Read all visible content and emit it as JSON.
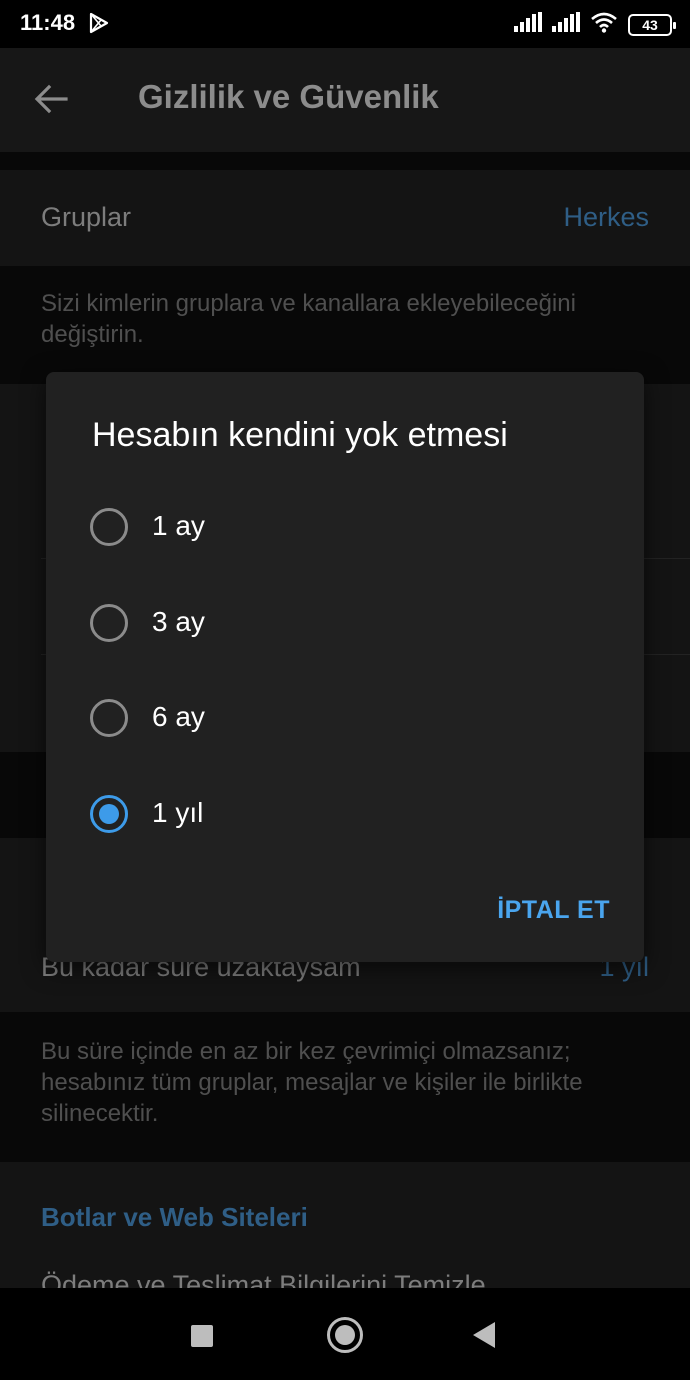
{
  "status_bar": {
    "time": "11:48",
    "battery": "43",
    "icons": [
      "play-store-icon",
      "signal-icon",
      "signal-icon-2",
      "wifi-icon",
      "battery-icon"
    ]
  },
  "app_bar": {
    "title": "Gizlilik ve Güvenlik",
    "back_icon": "arrow-left-icon"
  },
  "background": {
    "groups_row": {
      "label": "Gruplar",
      "value": "Herkes"
    },
    "groups_hint": "Sizi kimlerin gruplara ve kanallara ekleyebileceğini değiştirin.",
    "self_destruct_row": {
      "label": "Bu kadar süre uzaktaysam",
      "value": "1 yıl"
    },
    "self_destruct_hint": "Bu süre içinde en az bir kez çevrimiçi olmazsanız; hesabınız tüm gruplar, mesajlar ve kişiler ile birlikte silinecektir.",
    "bots_section_header": "Botlar ve Web Siteleri",
    "clear_payment_row": "Ödeme ve Teslimat Bilgilerini Temizle"
  },
  "dialog": {
    "title": "Hesabın kendini yok etmesi",
    "options": [
      {
        "label": "1 ay",
        "checked": false
      },
      {
        "label": "3 ay",
        "checked": false
      },
      {
        "label": "6 ay",
        "checked": false
      },
      {
        "label": "1 yıl",
        "checked": true
      }
    ],
    "cancel_label": "İPTAL ET",
    "accent_color": "#3d9be9"
  },
  "nav_bar": {
    "icons": [
      "recent-apps-icon",
      "home-icon",
      "back-icon"
    ]
  }
}
